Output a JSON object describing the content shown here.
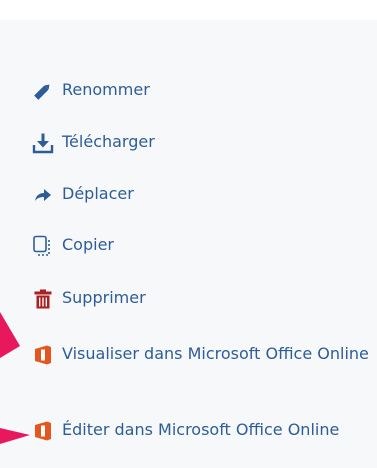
{
  "menu": {
    "items": [
      {
        "label": "Renommer",
        "icon": "pencil-icon",
        "color": "#2d5d99"
      },
      {
        "label": "Télécharger",
        "icon": "download-icon",
        "color": "#2d5d99"
      },
      {
        "label": "Déplacer",
        "icon": "move-arrow-icon",
        "color": "#2d5d99"
      },
      {
        "label": "Copier",
        "icon": "copy-icon",
        "color": "#2d5d99"
      },
      {
        "label": "Supprimer",
        "icon": "trash-icon",
        "color": "#aa1f1f"
      },
      {
        "label": "Visualiser dans Microsoft Office Online",
        "icon": "office-icon",
        "color": "#e3561d"
      },
      {
        "label": "Éditer dans Microsoft Office Online",
        "icon": "office-icon",
        "color": "#e3561d"
      }
    ]
  },
  "annotation": {
    "arrow_color": "#e8185c"
  }
}
